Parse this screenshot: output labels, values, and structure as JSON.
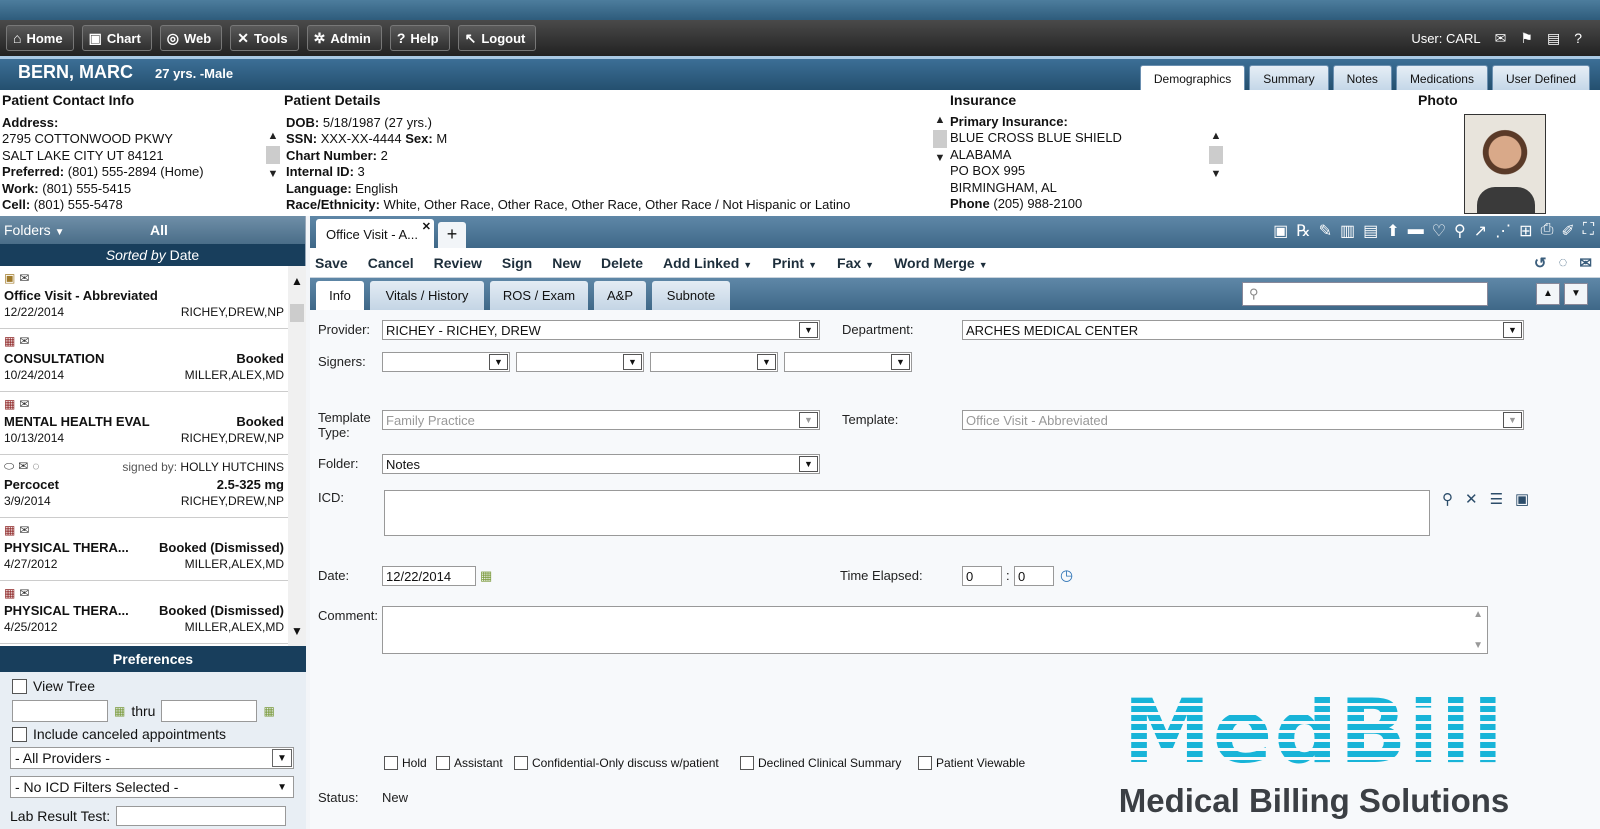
{
  "nav": {
    "items": [
      {
        "label": "Home",
        "icon": "home-icon",
        "glyph": "⌂"
      },
      {
        "label": "Chart",
        "icon": "chart-icon",
        "glyph": "▣"
      },
      {
        "label": "Web",
        "icon": "web-icon",
        "glyph": "◎"
      },
      {
        "label": "Tools",
        "icon": "tools-icon",
        "glyph": "✕"
      },
      {
        "label": "Admin",
        "icon": "admin-icon",
        "glyph": "✲"
      },
      {
        "label": "Help",
        "icon": "help-icon",
        "glyph": "?"
      },
      {
        "label": "Logout",
        "icon": "logout-icon",
        "glyph": "↖"
      }
    ],
    "user_label": "User: CARL"
  },
  "patient": {
    "name": "BERN, MARC",
    "age_sex": "27 yrs. -Male",
    "tabs": [
      "Demographics",
      "Summary",
      "Notes",
      "Medications",
      "User Defined"
    ],
    "active_tab": "Demographics"
  },
  "demographics": {
    "contact_heading": "Patient Contact Info",
    "details_heading": "Patient Details",
    "insurance_heading": "Insurance",
    "photo_heading": "Photo",
    "address_label": "Address:",
    "address_line1": "2795 COTTONWOOD PKWY",
    "address_line2": "SALT LAKE CITY UT 84121",
    "preferred_label": "Preferred:",
    "preferred_value": "(801) 555-2894 (Home)",
    "work_label": "Work:",
    "work_value": "(801) 555-5415",
    "cell_label": "Cell:",
    "cell_value": "(801) 555-5478",
    "dob_label": "DOB:",
    "dob_value": "5/18/1987 (27 yrs.)",
    "ssn_label": "SSN:",
    "ssn_value": "XXX-XX-4444",
    "sex_label": "Sex:",
    "sex_value": "M",
    "chart_label": "Chart Number:",
    "chart_value": "2",
    "internal_label": "Internal ID:",
    "internal_value": "3",
    "language_label": "Language:",
    "language_value": "English",
    "race_label": "Race/Ethnicity:",
    "race_value": "White, Other Race, Other Race, Other Race, Other Race / Not Hispanic or Latino",
    "ins_primary_label": "Primary Insurance:",
    "ins_line1": "BLUE CROSS BLUE SHIELD",
    "ins_line2": "ALABAMA",
    "ins_line3": "PO BOX 995",
    "ins_line4": "BIRMINGHAM, AL",
    "ins_phone_label": "Phone",
    "ins_phone_value": "(205) 988-2100"
  },
  "folders": {
    "label": "Folders",
    "filter": "All",
    "sorted_prefix": "Sorted by",
    "sorted_field": "Date",
    "items": [
      {
        "title": "Office Visit - Abbreviated",
        "status": "",
        "date": "12/22/2014",
        "provider": "RICHEY,DREW,NP"
      },
      {
        "title": "CONSULTATION",
        "status": "Booked",
        "date": "10/24/2014",
        "provider": "MILLER,ALEX,MD"
      },
      {
        "title": "MENTAL HEALTH EVAL",
        "status": "Booked",
        "date": "10/13/2014",
        "provider": "RICHEY,DREW,NP"
      },
      {
        "title": "Percocet",
        "status": "2.5-325 mg",
        "date": "3/9/2014",
        "provider": "RICHEY,DREW,NP",
        "signed_prefix": "signed by:",
        "signed_by": "HOLLY HUTCHINS"
      },
      {
        "title": "PHYSICAL THERA...",
        "status": "Booked (Dismissed)",
        "date": "4/27/2012",
        "provider": "MILLER,ALEX,MD"
      },
      {
        "title": "PHYSICAL THERA...",
        "status": "Booked (Dismissed)",
        "date": "4/25/2012",
        "provider": "MILLER,ALEX,MD"
      }
    ]
  },
  "preferences": {
    "heading": "Preferences",
    "view_tree": "View Tree",
    "thru": "thru",
    "include_canceled": "Include canceled appointments",
    "providers": "- All Providers -",
    "icd_filter": "- No ICD Filters Selected -",
    "lab_result_label": "Lab Result Test:"
  },
  "document": {
    "tab_label": "Office Visit - A...",
    "actions": [
      "Save",
      "Cancel",
      "Review",
      "Sign",
      "New",
      "Delete"
    ],
    "dropdown_actions": [
      "Add Linked",
      "Print",
      "Fax",
      "Word Merge"
    ],
    "subtabs": [
      "Info",
      "Vitals / History",
      "ROS / Exam",
      "A&P",
      "Subnote"
    ],
    "active_subtab": "Info",
    "search_placeholder": ""
  },
  "form": {
    "provider_label": "Provider:",
    "provider_value": "RICHEY - RICHEY, DREW",
    "department_label": "Department:",
    "department_value": "ARCHES MEDICAL CENTER",
    "signers_label": "Signers:",
    "template_type_label": "Template Type:",
    "template_type_value": "Family Practice",
    "template_label": "Template:",
    "template_value": "Office Visit - Abbreviated",
    "folder_label": "Folder:",
    "folder_value": "Notes",
    "icd_label": "ICD:",
    "date_label": "Date:",
    "date_value": "12/22/2014",
    "time_elapsed_label": "Time Elapsed:",
    "time_hours": "0",
    "time_minutes": "0",
    "time_sep": ":",
    "comment_label": "Comment:",
    "checkboxes": [
      "Hold",
      "Assistant",
      "Confidential-Only discuss w/patient",
      "Declined Clinical Summary",
      "Patient Viewable"
    ],
    "status_label": "Status:",
    "status_value": "New"
  },
  "watermark": {
    "logo_text": "MedBill",
    "tagline": "Medical Billing Solutions"
  },
  "colors": {
    "accent": "#3f6888",
    "dark_header": "#183e5c",
    "brand": "#18b4d8"
  }
}
